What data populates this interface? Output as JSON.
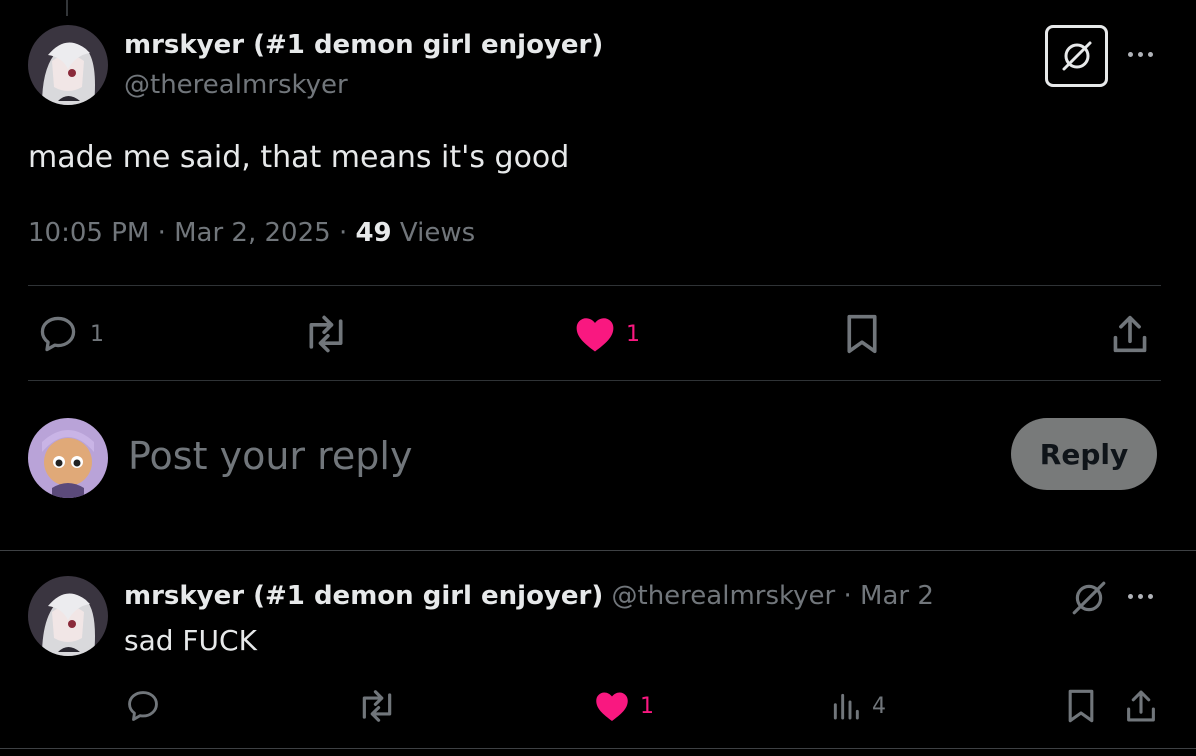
{
  "main_post": {
    "display_name": "mrskyer (#1 demon girl enjoyer)",
    "handle": "@therealmrskyer",
    "text": "made me said, that means it's good",
    "time": "10:05 PM",
    "sep1": "·",
    "date": "Mar 2, 2025",
    "sep2": "·",
    "views_count": "49",
    "views_label": "Views",
    "actions": {
      "reply_count": "1",
      "like_count": "1"
    }
  },
  "composer": {
    "placeholder": "Post your reply",
    "button_label": "Reply"
  },
  "reply_post": {
    "display_name": "mrskyer (#1 demon girl enjoyer)",
    "handle": "@therealmrskyer",
    "sep": "·",
    "date": "Mar 2",
    "text": "sad FUCK",
    "actions": {
      "like_count": "1",
      "views_count": "4"
    }
  },
  "icons": [
    "grok-icon",
    "more-icon",
    "reply-icon",
    "repost-icon",
    "heart-icon",
    "bookmark-icon",
    "share-icon",
    "views-icon"
  ],
  "colors": {
    "background": "#000000",
    "text": "#e7e9ea",
    "muted": "#71767b",
    "like": "#f91880",
    "reply_button": "#787a7a",
    "divider": "#2f3336"
  }
}
